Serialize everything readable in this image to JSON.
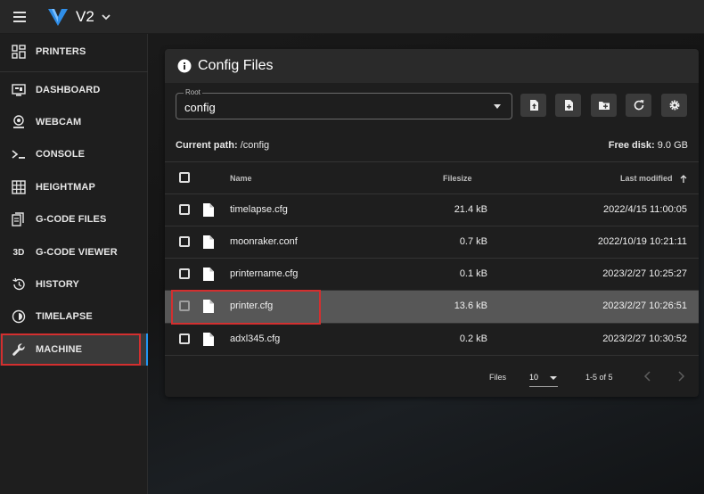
{
  "app": {
    "title": "V2"
  },
  "sidebar": {
    "items": [
      {
        "label": "PRINTERS",
        "icon": "printers-grid-icon"
      },
      {
        "label": "DASHBOARD",
        "icon": "dashboard-icon"
      },
      {
        "label": "WEBCAM",
        "icon": "webcam-icon"
      },
      {
        "label": "CONSOLE",
        "icon": "console-icon"
      },
      {
        "label": "HEIGHTMAP",
        "icon": "heightmap-grid-icon"
      },
      {
        "label": "G-CODE FILES",
        "icon": "gcode-files-icon"
      },
      {
        "label": "G-CODE VIEWER",
        "icon": "3d-icon",
        "icon_text": "3D"
      },
      {
        "label": "HISTORY",
        "icon": "history-icon"
      },
      {
        "label": "TIMELAPSE",
        "icon": "timelapse-icon"
      },
      {
        "label": "MACHINE",
        "icon": "wrench-icon",
        "active": true
      }
    ]
  },
  "card": {
    "title": "Config Files",
    "root_label": "Root",
    "root_value": "config",
    "toolbar": [
      "upload-file-icon",
      "new-file-icon",
      "new-folder-icon",
      "refresh-icon",
      "settings-gear-icon"
    ],
    "current_path_label": "Current path:",
    "current_path_value": "/config",
    "free_disk_label": "Free disk:",
    "free_disk_value": "9.0 GB"
  },
  "table": {
    "headers": {
      "name": "Name",
      "size": "Filesize",
      "modified": "Last modified"
    },
    "rows": [
      {
        "name": "timelapse.cfg",
        "size": "21.4 kB",
        "modified": "2022/4/15 11:00:05"
      },
      {
        "name": "moonraker.conf",
        "size": "0.7 kB",
        "modified": "2022/10/19 10:21:11"
      },
      {
        "name": "printername.cfg",
        "size": "0.1 kB",
        "modified": "2023/2/27 10:25:27"
      },
      {
        "name": "printer.cfg",
        "size": "13.6 kB",
        "modified": "2023/2/27 10:26:51",
        "selected": true
      },
      {
        "name": "adxl345.cfg",
        "size": "0.2 kB",
        "modified": "2023/2/27 10:30:52"
      }
    ],
    "footer": {
      "files_label": "Files",
      "per_page": "10",
      "range": "1-5 of 5"
    }
  },
  "colors": {
    "accent": "#2196f3",
    "highlight": "#d32f2f",
    "selected_row": "#575757"
  }
}
